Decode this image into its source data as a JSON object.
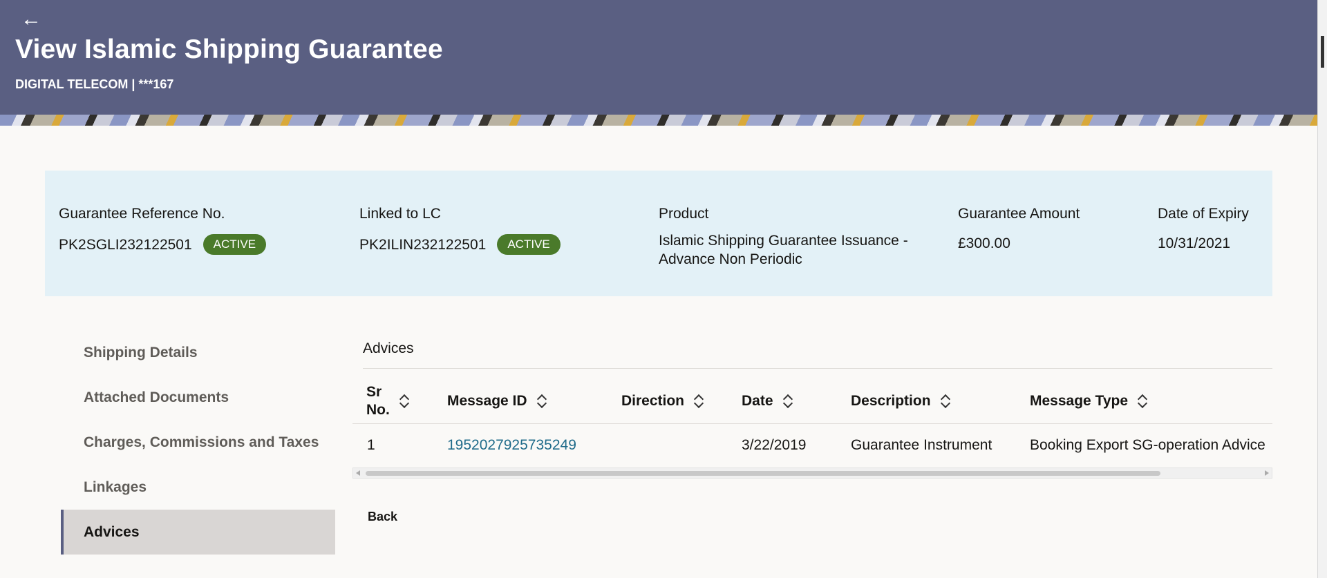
{
  "header": {
    "back_icon": "←",
    "title": "View Islamic Shipping Guarantee",
    "subtitle": "DIGITAL TELECOM | ***167"
  },
  "summary": {
    "guarantee_ref_label": "Guarantee Reference No.",
    "guarantee_ref_value": "PK2SGLI232122501",
    "guarantee_ref_status": "ACTIVE",
    "linked_lc_label": "Linked to LC",
    "linked_lc_value": "PK2ILIN232122501",
    "linked_lc_status": "ACTIVE",
    "product_label": "Product",
    "product_value": "Islamic Shipping Guarantee Issuance - Advance Non Periodic",
    "amount_label": "Guarantee Amount",
    "amount_value": "£300.00",
    "expiry_label": "Date of Expiry",
    "expiry_value": "10/31/2021",
    "badge_color": "#4a7a2a"
  },
  "nav": {
    "items": [
      {
        "label": "Shipping Details"
      },
      {
        "label": "Attached Documents"
      },
      {
        "label": "Charges, Commissions and Taxes"
      },
      {
        "label": "Linkages"
      },
      {
        "label": "Advices",
        "active": true
      }
    ]
  },
  "advices": {
    "section_title": "Advices",
    "columns": {
      "sr_no_line1": "Sr",
      "sr_no_line2": "No.",
      "message_id": "Message ID",
      "direction": "Direction",
      "date": "Date",
      "description": "Description",
      "message_type": "Message Type"
    },
    "rows": [
      {
        "sr_no": "1",
        "message_id": "1952027925735249",
        "direction": "",
        "date": "3/22/2019",
        "description": "Guarantee Instrument",
        "message_type": "Booking Export SG-operation Advice"
      }
    ]
  },
  "footer": {
    "back_label": "Back"
  },
  "colors": {
    "header_bg": "#5a5f82",
    "summary_bg": "#e3f1f7",
    "link": "#1f6b8a"
  }
}
